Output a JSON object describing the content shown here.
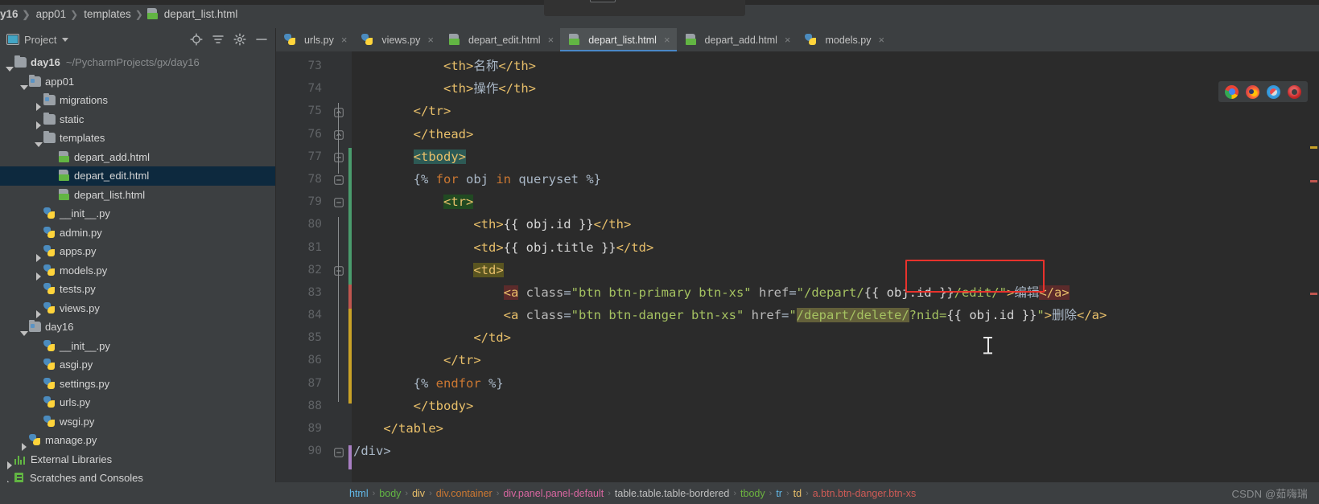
{
  "window": {
    "app": "PyCharm",
    "breadcrumb": [
      {
        "label": "y16",
        "icon": "",
        "bold": true
      },
      {
        "label": "app01",
        "icon": ""
      },
      {
        "label": "templates",
        "icon": ""
      },
      {
        "label": "depart_list.html",
        "icon": "html-file-icon"
      }
    ]
  },
  "project_panel": {
    "title": "Project",
    "toolbar_icons": [
      "locate-icon",
      "collapse-all-icon",
      "settings-gear-icon",
      "hide-icon"
    ],
    "tree": [
      {
        "label": "day16",
        "path": "~/PycharmProjects/gx/day16",
        "icon": "folder-icon",
        "arrow": "down",
        "indent": 1,
        "bold": true,
        "selected": false
      },
      {
        "label": "app01",
        "path": "",
        "icon": "module-folder-icon",
        "arrow": "down",
        "indent": 2,
        "bold": false,
        "selected": false
      },
      {
        "label": "migrations",
        "path": "",
        "icon": "module-folder-icon",
        "arrow": "right",
        "indent": 3,
        "bold": false,
        "selected": false
      },
      {
        "label": "static",
        "path": "",
        "icon": "folder-icon",
        "arrow": "right",
        "indent": 3,
        "bold": false,
        "selected": false
      },
      {
        "label": "templates",
        "path": "",
        "icon": "folder-icon",
        "arrow": "down",
        "indent": 3,
        "bold": false,
        "selected": false
      },
      {
        "label": "depart_add.html",
        "path": "",
        "icon": "html-file-icon",
        "arrow": "",
        "indent": 4,
        "bold": false,
        "selected": false
      },
      {
        "label": "depart_edit.html",
        "path": "",
        "icon": "html-file-icon",
        "arrow": "",
        "indent": 4,
        "bold": false,
        "selected": true
      },
      {
        "label": "depart_list.html",
        "path": "",
        "icon": "html-file-icon",
        "arrow": "",
        "indent": 4,
        "bold": false,
        "selected": false
      },
      {
        "label": "__init__.py",
        "path": "",
        "icon": "python-file-icon",
        "arrow": "",
        "indent": 3,
        "bold": false,
        "selected": false
      },
      {
        "label": "admin.py",
        "path": "",
        "icon": "python-file-icon",
        "arrow": "",
        "indent": 3,
        "bold": false,
        "selected": false
      },
      {
        "label": "apps.py",
        "path": "",
        "icon": "python-file-icon",
        "arrow": "right",
        "indent": 3,
        "bold": false,
        "selected": false
      },
      {
        "label": "models.py",
        "path": "",
        "icon": "python-file-icon",
        "arrow": "right",
        "indent": 3,
        "bold": false,
        "selected": false
      },
      {
        "label": "tests.py",
        "path": "",
        "icon": "python-file-icon",
        "arrow": "",
        "indent": 3,
        "bold": false,
        "selected": false
      },
      {
        "label": "views.py",
        "path": "",
        "icon": "python-file-icon",
        "arrow": "right",
        "indent": 3,
        "bold": false,
        "selected": false
      },
      {
        "label": "day16",
        "path": "",
        "icon": "module-folder-icon",
        "arrow": "down",
        "indent": 2,
        "bold": false,
        "selected": false
      },
      {
        "label": "__init__.py",
        "path": "",
        "icon": "python-file-icon",
        "arrow": "",
        "indent": 3,
        "bold": false,
        "selected": false
      },
      {
        "label": "asgi.py",
        "path": "",
        "icon": "python-file-icon",
        "arrow": "",
        "indent": 3,
        "bold": false,
        "selected": false
      },
      {
        "label": "settings.py",
        "path": "",
        "icon": "python-file-icon",
        "arrow": "",
        "indent": 3,
        "bold": false,
        "selected": false
      },
      {
        "label": "urls.py",
        "path": "",
        "icon": "python-file-icon",
        "arrow": "",
        "indent": 3,
        "bold": false,
        "selected": false
      },
      {
        "label": "wsgi.py",
        "path": "",
        "icon": "python-file-icon",
        "arrow": "",
        "indent": 3,
        "bold": false,
        "selected": false
      },
      {
        "label": "manage.py",
        "path": "",
        "icon": "python-file-icon",
        "arrow": "right",
        "indent": 2,
        "bold": false,
        "selected": false
      },
      {
        "label": "External Libraries",
        "path": "",
        "icon": "external-libraries-icon",
        "arrow": "right",
        "indent": 1,
        "bold": false,
        "selected": false
      },
      {
        "label": "Scratches and Consoles",
        "path": "",
        "icon": "scratches-icon",
        "arrow": "right",
        "indent": 1,
        "bold": false,
        "selected": false
      }
    ]
  },
  "editor_tabs": [
    {
      "label": "urls.py",
      "icon": "python-file-icon",
      "active": false,
      "close": "×"
    },
    {
      "label": "views.py",
      "icon": "python-file-icon",
      "active": false,
      "close": "×"
    },
    {
      "label": "depart_edit.html",
      "icon": "html-file-icon",
      "active": false,
      "close": "×"
    },
    {
      "label": "depart_list.html",
      "icon": "html-file-icon",
      "active": true,
      "close": "×"
    },
    {
      "label": "depart_add.html",
      "icon": "html-file-icon",
      "active": false,
      "close": "×"
    },
    {
      "label": "models.py",
      "icon": "python-file-icon",
      "active": false,
      "close": "×"
    }
  ],
  "editor": {
    "language": "HTML / Django template",
    "line_numbers": [
      73,
      74,
      75,
      76,
      77,
      78,
      79,
      80,
      81,
      82,
      83,
      84,
      85,
      86,
      87,
      88,
      89,
      90
    ],
    "lines": [
      {
        "n": 73,
        "text": "            <th>名称</th>"
      },
      {
        "n": 74,
        "text": "            <th>操作</th>"
      },
      {
        "n": 75,
        "text": "        </tr>"
      },
      {
        "n": 76,
        "text": "        </thead>"
      },
      {
        "n": 77,
        "text": "        <tbody>"
      },
      {
        "n": 78,
        "text": "        {% for obj in queryset %}"
      },
      {
        "n": 79,
        "text": "            <tr>"
      },
      {
        "n": 80,
        "text": "                <th>{{ obj.id }}</th>"
      },
      {
        "n": 81,
        "text": "                <td>{{ obj.title }}</td>"
      },
      {
        "n": 82,
        "text": "                <td>"
      },
      {
        "n": 83,
        "text": "                    <a class=\"btn btn-primary btn-xs\" href=\"/depart/{{ obj.id }}/edit/\">编辑</a>"
      },
      {
        "n": 84,
        "text": "                    <a class=\"btn btn-danger btn-xs\" href=\"/depart/delete/?nid={{ obj.id }}\">删除</a>"
      },
      {
        "n": 85,
        "text": "                </td>"
      },
      {
        "n": 86,
        "text": "            </tr>"
      },
      {
        "n": 87,
        "text": "        {% endfor %}"
      },
      {
        "n": 88,
        "text": "        </tbody>"
      },
      {
        "n": 89,
        "text": "    </table>"
      },
      {
        "n": 90,
        "text": "/div>"
      }
    ]
  },
  "browser_launchers": [
    "chrome-icon",
    "firefox-icon",
    "safari-icon",
    "ie-icon"
  ],
  "annotation": {
    "shape": "red-rectangle",
    "target": "/depart/{{ obj.id }}/edit/"
  },
  "status_breadcrumb": [
    {
      "label": "html",
      "color": "#62b8e8"
    },
    {
      "label": "body",
      "color": "#62b543"
    },
    {
      "label": "div",
      "color": "#e8bf6a"
    },
    {
      "label": "div.container",
      "color": "#cc7832"
    },
    {
      "label": "div.panel.panel-default",
      "color": "#d866a0"
    },
    {
      "label": "table.table.table-bordered",
      "color": "#bfbfbf"
    },
    {
      "label": "tbody",
      "color": "#6cb33f"
    },
    {
      "label": "tr",
      "color": "#62b8e8"
    },
    {
      "label": "td",
      "color": "#e8bf6a"
    },
    {
      "label": "a.btn.btn-danger.btn-xs",
      "color": "#cf5b56"
    }
  ],
  "watermark": "CSDN @茹嗨瑞"
}
